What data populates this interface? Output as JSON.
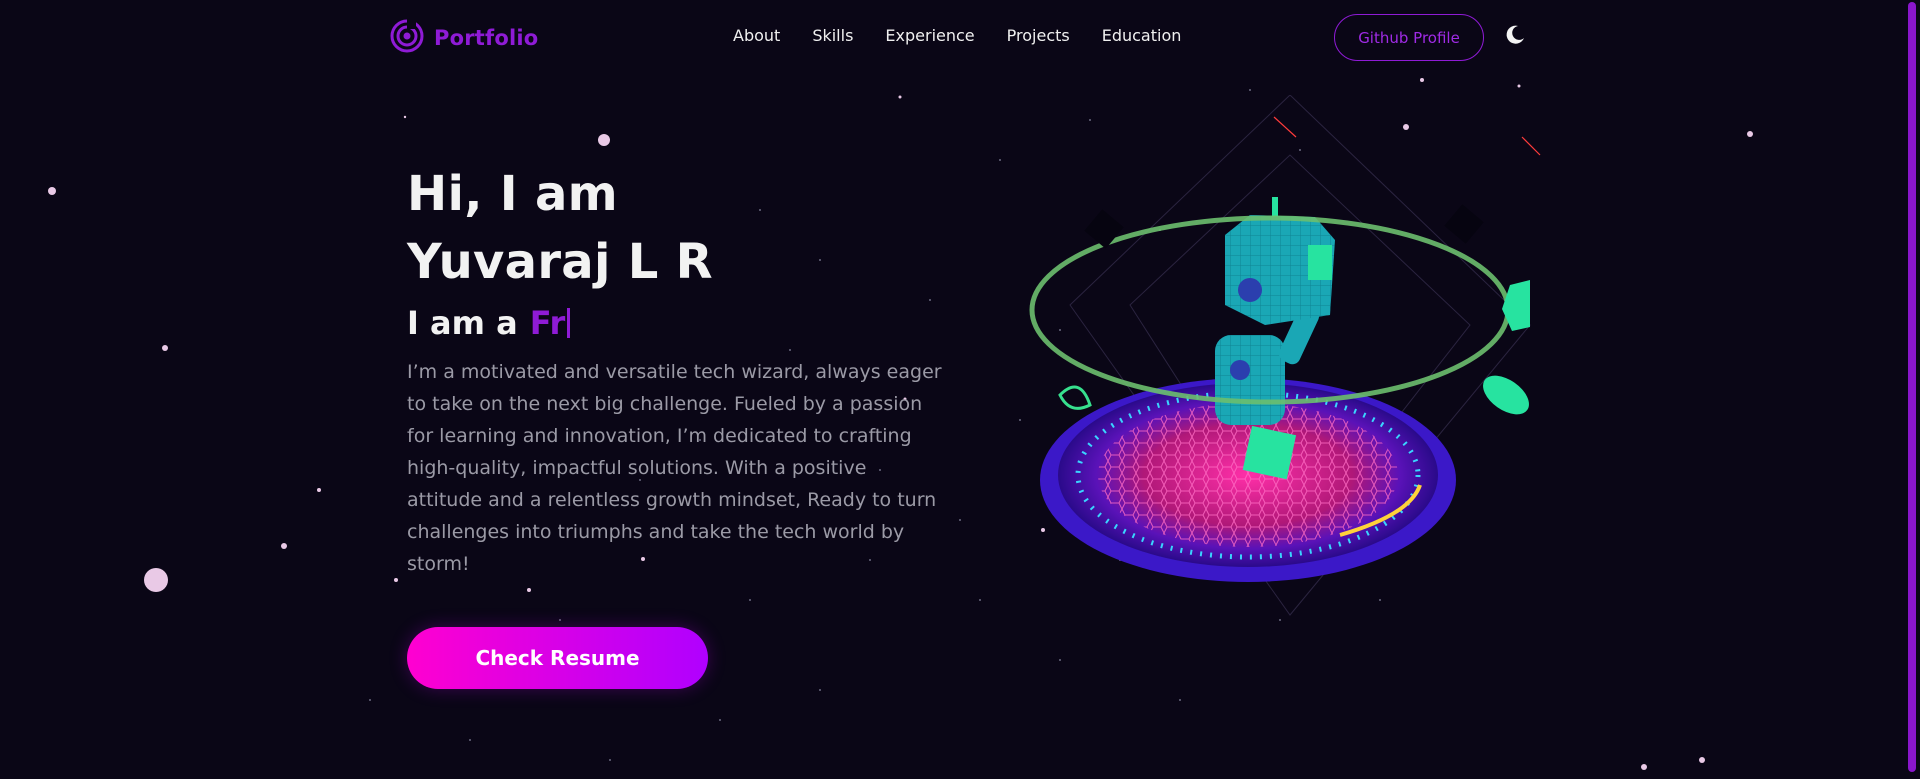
{
  "nav": {
    "brand": "Portfolio",
    "links": [
      "About",
      "Skills",
      "Experience",
      "Projects",
      "Education"
    ],
    "github_label": "Github Profile"
  },
  "hero": {
    "greeting": "Hi, I am",
    "name": "Yuvaraj L R",
    "role_prefix": "I am a",
    "role_typed": "Fr",
    "bio": "I’m a motivated and versatile tech wizard, always eager to take on the next big challenge. Fueled by a passion for learning and innovation, I’m dedicated to crafting high-quality, impactful solutions. With a positive attitude and a relentless growth mindset, Ready to turn challenges into triumphs and take the tech world by storm!",
    "resume_label": "Check Resume"
  },
  "colors": {
    "background": "#0a0616",
    "accent": "#8f1bd6",
    "button_gradient_start": "#ff00d0",
    "button_gradient_end": "#b000ff"
  },
  "icons": {
    "brand": "spiral-logo-icon",
    "theme": "moon-icon"
  }
}
